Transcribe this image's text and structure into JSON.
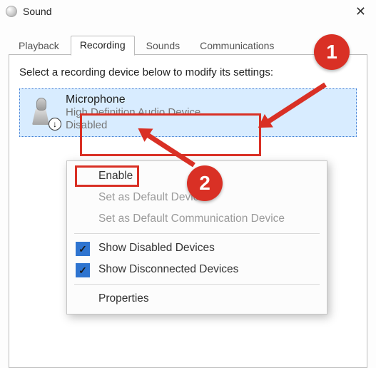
{
  "window": {
    "title": "Sound"
  },
  "tabs": {
    "playback": "Playback",
    "recording": "Recording",
    "sounds": "Sounds",
    "communications": "Communications",
    "active": "recording"
  },
  "instruction": "Select a recording device below to modify its settings:",
  "device": {
    "name": "Microphone",
    "description": "High Definition Audio Device",
    "status": "Disabled"
  },
  "context_menu": {
    "enable": "Enable",
    "set_default": "Set as Default Device",
    "set_default_comm": "Set as Default Communication Device",
    "show_disabled": "Show Disabled Devices",
    "show_disconnected": "Show Disconnected Devices",
    "properties": "Properties",
    "show_disabled_checked": true,
    "show_disconnected_checked": true
  },
  "annotations": {
    "badge1": "1",
    "badge2": "2"
  },
  "colors": {
    "accent_red": "#d93025",
    "selection_blue": "#d8ecff"
  }
}
